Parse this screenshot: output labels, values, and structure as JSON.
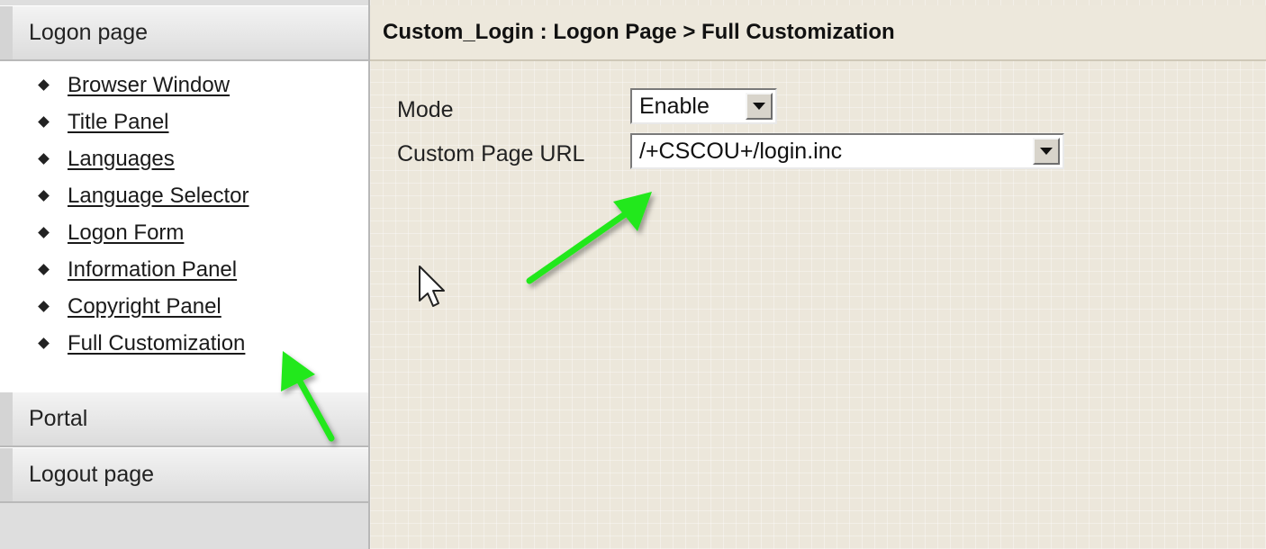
{
  "sidebar": {
    "sections": {
      "logon_page": "Logon page",
      "portal": "Portal",
      "logout_page": "Logout page"
    },
    "links": [
      "Browser Window",
      "Title Panel",
      "Languages",
      "Language Selector",
      "Logon Form",
      "Information Panel",
      "Copyright Panel",
      "Full Customization"
    ]
  },
  "main": {
    "title": "Custom_Login : Logon Page > Full Customization",
    "mode": {
      "label": "Mode",
      "value": "Enable"
    },
    "custom_page_url": {
      "label": "Custom Page URL",
      "value": "/+CSCOU+/login.inc"
    }
  },
  "colors": {
    "annotation_arrow": "#22e81c",
    "main_background": "#ece7db",
    "sidebar_background": "#dedede"
  },
  "icons": {
    "dropdown": "chevron-down-icon",
    "cursor": "mouse-pointer-icon",
    "annotation": "arrow-annotation-icon"
  }
}
